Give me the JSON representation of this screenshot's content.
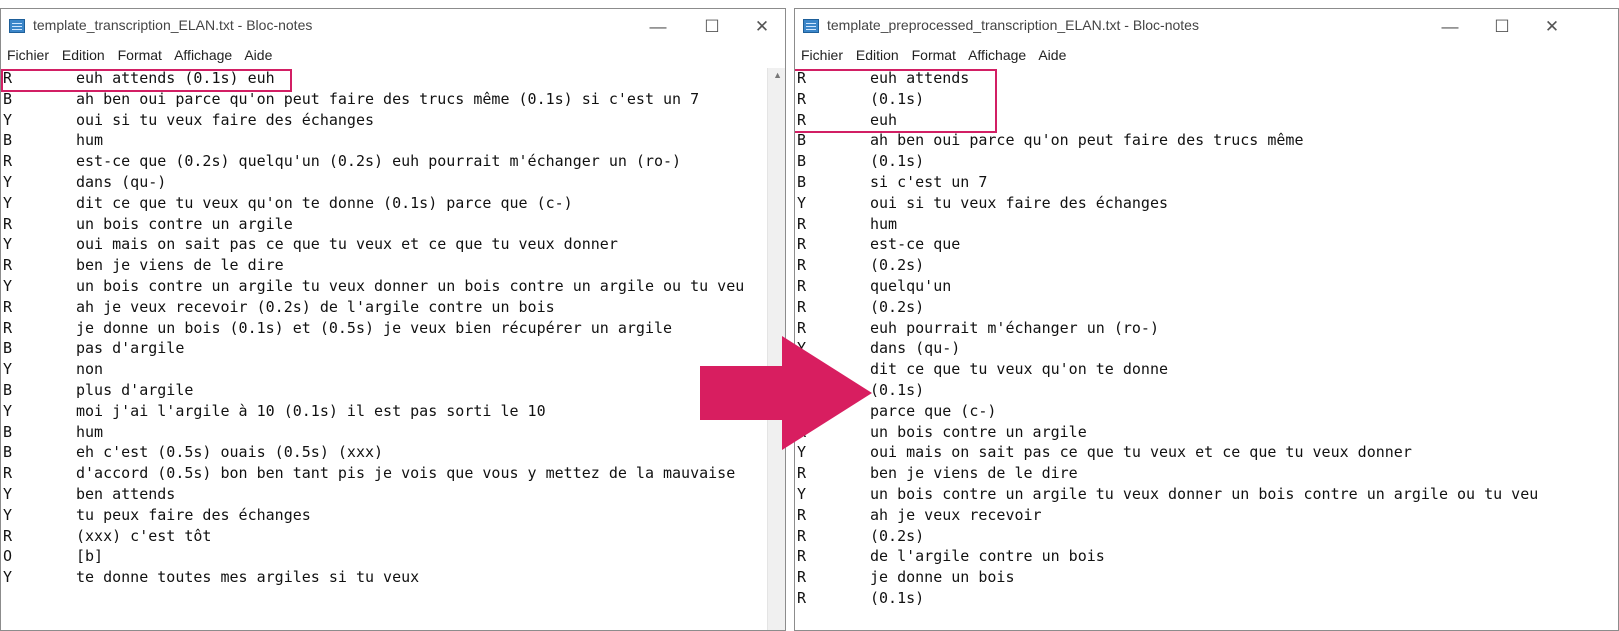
{
  "left_window": {
    "title": "template_transcription_ELAN.txt - Bloc-notes",
    "menu": [
      "Fichier",
      "Edition",
      "Format",
      "Affichage",
      "Aide"
    ],
    "controls": {
      "minimize": "—",
      "maximize": "☐",
      "close": "✕"
    },
    "lines": [
      {
        "speaker": "R",
        "text": "euh attends (0.1s) euh"
      },
      {
        "speaker": "B",
        "text": "ah ben oui parce qu'on peut faire des trucs même (0.1s) si c'est un 7"
      },
      {
        "speaker": "Y",
        "text": "oui si tu veux faire des échanges"
      },
      {
        "speaker": "B",
        "text": "hum"
      },
      {
        "speaker": "R",
        "text": "est-ce que (0.2s) quelqu'un (0.2s) euh pourrait m'échanger un (ro-)"
      },
      {
        "speaker": "Y",
        "text": "dans (qu-)"
      },
      {
        "speaker": "Y",
        "text": "dit ce que tu veux qu'on te donne (0.1s) parce que (c-)"
      },
      {
        "speaker": "R",
        "text": "un bois contre un argile"
      },
      {
        "speaker": "Y",
        "text": "oui mais on sait pas ce que tu veux et ce que tu veux donner"
      },
      {
        "speaker": "R",
        "text": "ben je viens de le dire"
      },
      {
        "speaker": "Y",
        "text": "un bois contre un argile tu veux donner un bois contre un argile ou tu veu"
      },
      {
        "speaker": "R",
        "text": "ah je veux recevoir (0.2s) de l'argile contre un bois"
      },
      {
        "speaker": "R",
        "text": "je donne un bois (0.1s) et (0.5s) je veux bien récupérer un argile"
      },
      {
        "speaker": "B",
        "text": "pas d'argile"
      },
      {
        "speaker": "Y",
        "text": "non"
      },
      {
        "speaker": "B",
        "text": "plus d'argile"
      },
      {
        "speaker": "Y",
        "text": "moi j'ai l'argile à 10 (0.1s) il est pas sorti le 10"
      },
      {
        "speaker": "B",
        "text": "hum"
      },
      {
        "speaker": "B",
        "text": "eh c'est (0.5s) ouais (0.5s) (xxx)"
      },
      {
        "speaker": "R",
        "text": "d'accord (0.5s) bon ben tant pis je vois que vous y mettez de la mauvaise"
      },
      {
        "speaker": "Y",
        "text": "ben attends"
      },
      {
        "speaker": "Y",
        "text": "tu peux faire des échanges"
      },
      {
        "speaker": "R",
        "text": "(xxx) c'est tôt"
      },
      {
        "speaker": "O",
        "text": "[b]"
      },
      {
        "speaker": "Y",
        "text": "te donne toutes mes argiles si tu veux"
      }
    ]
  },
  "right_window": {
    "title": "template_preprocessed_transcription_ELAN.txt - Bloc-notes",
    "menu": [
      "Fichier",
      "Edition",
      "Format",
      "Affichage",
      "Aide"
    ],
    "controls": {
      "minimize": "—",
      "maximize": "☐",
      "close": "✕"
    },
    "lines": [
      {
        "speaker": "R",
        "text": "euh attends"
      },
      {
        "speaker": "R",
        "text": "(0.1s)"
      },
      {
        "speaker": "R",
        "text": "euh"
      },
      {
        "speaker": "B",
        "text": "ah ben oui parce qu'on peut faire des trucs même"
      },
      {
        "speaker": "B",
        "text": "(0.1s)"
      },
      {
        "speaker": "B",
        "text": "si c'est un 7"
      },
      {
        "speaker": "Y",
        "text": "oui si tu veux faire des échanges"
      },
      {
        "speaker": "R",
        "text": "hum"
      },
      {
        "speaker": "R",
        "text": "est-ce que"
      },
      {
        "speaker": "R",
        "text": "(0.2s)"
      },
      {
        "speaker": "R",
        "text": "quelqu'un"
      },
      {
        "speaker": "R",
        "text": "(0.2s)"
      },
      {
        "speaker": "R",
        "text": "euh pourrait m'échanger un (ro-)"
      },
      {
        "speaker": "Y",
        "text": "dans (qu-)"
      },
      {
        "speaker": "Y",
        "text": "dit ce que tu veux qu'on te donne"
      },
      {
        "speaker": "Y",
        "text": "(0.1s)"
      },
      {
        "speaker": "Y",
        "text": "parce que (c-)"
      },
      {
        "speaker": "R",
        "text": "un bois contre un argile"
      },
      {
        "speaker": "Y",
        "text": "oui mais on sait pas ce que tu veux et ce que tu veux donner"
      },
      {
        "speaker": "R",
        "text": "ben je viens de le dire"
      },
      {
        "speaker": "Y",
        "text": "un bois contre un argile tu veux donner un bois contre un argile ou tu veu"
      },
      {
        "speaker": "R",
        "text": "ah je veux recevoir"
      },
      {
        "speaker": "R",
        "text": "(0.2s)"
      },
      {
        "speaker": "R",
        "text": "de l'argile contre un bois"
      },
      {
        "speaker": "R",
        "text": "je donne un bois"
      },
      {
        "speaker": "R",
        "text": "(0.1s)"
      }
    ]
  },
  "colors": {
    "highlight": "#d21f64",
    "arrow": "#d81e60"
  }
}
